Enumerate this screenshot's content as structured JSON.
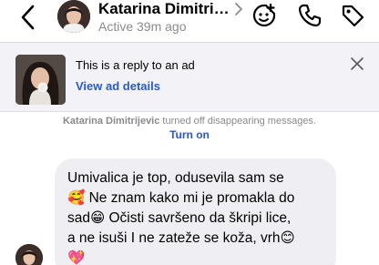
{
  "header": {
    "contact_name": "Katarina Dimitri…",
    "status": "Active 39m ago"
  },
  "icons": {
    "back": "chevron-left-icon",
    "name_chevron": "chevron-right-icon",
    "sticker": "sticker-add-icon",
    "call": "phone-icon",
    "label": "tag-icon",
    "close": "close-icon"
  },
  "ad_reply": {
    "title": "This is a reply to an ad",
    "link": "View ad details"
  },
  "system_message": {
    "name": "Katarina Dimitrijevic",
    "text": " turned off disappearing messages.",
    "action": "Turn on"
  },
  "message": {
    "text": "Umivalica je top, odusevila sam se\n🥰 Ne znam kako mi je promakla do\nsad😁 Očisti savršeno da škripi lice,\na ne isuši I ne zateže se koža, vrh😊\n💖"
  },
  "colors": {
    "link_blue": "#2b5bc2",
    "bubble_bg": "#efeff3",
    "card_bg": "#f2f2f7",
    "muted_text": "#8a8a8e"
  }
}
